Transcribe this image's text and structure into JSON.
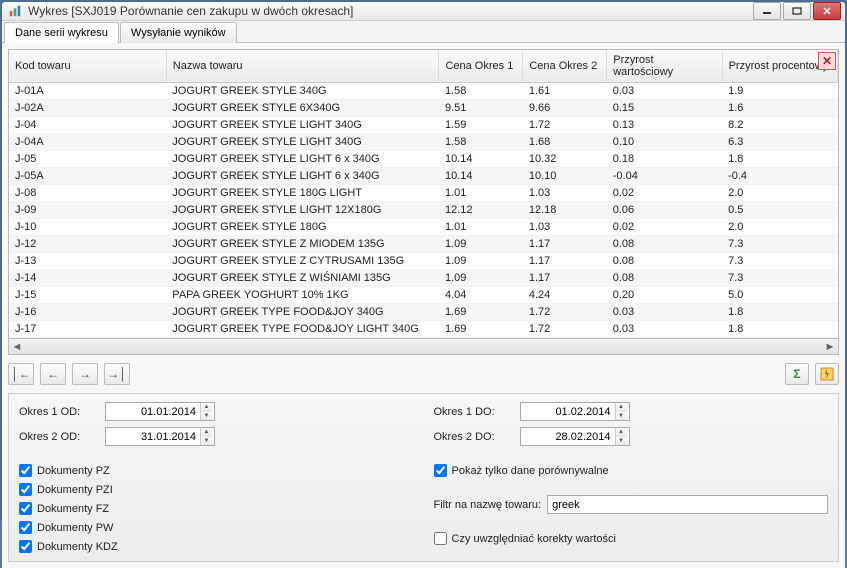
{
  "window": {
    "title": "Wykres [SXJ019 Porównanie cen zakupu w dwóch okresach]"
  },
  "tabs": [
    {
      "label": "Dane serii wykresu"
    },
    {
      "label": "Wysyłanie wyników"
    }
  ],
  "columns": {
    "kod": "Kod towaru",
    "nazwa": "Nazwa towaru",
    "c1": "Cena Okres 1",
    "c2": "Cena Okres 2",
    "pw": "Przyrost wartościowy",
    "pp": "Przyrost procentowy"
  },
  "rows": [
    {
      "kod": "J-01A",
      "nazwa": "JOGURT GREEK STYLE 340G",
      "c1": "1.58",
      "c2": "1.61",
      "pw": "0.03",
      "pp": "1.9"
    },
    {
      "kod": "J-02A",
      "nazwa": "JOGURT GREEK STYLE 6X340G",
      "c1": "9.51",
      "c2": "9.66",
      "pw": "0.15",
      "pp": "1.6"
    },
    {
      "kod": "J-04",
      "nazwa": "JOGURT GREEK STYLE LIGHT 340G",
      "c1": "1.59",
      "c2": "1.72",
      "pw": "0.13",
      "pp": "8.2"
    },
    {
      "kod": "J-04A",
      "nazwa": "JOGURT GREEK STYLE LIGHT 340G",
      "c1": "1.58",
      "c2": "1.68",
      "pw": "0.10",
      "pp": "6.3"
    },
    {
      "kod": "J-05",
      "nazwa": "JOGURT GREEK STYLE LIGHT 6 x 340G",
      "c1": "10.14",
      "c2": "10.32",
      "pw": "0.18",
      "pp": "1.8"
    },
    {
      "kod": "J-05A",
      "nazwa": "JOGURT GREEK STYLE LIGHT 6 x 340G",
      "c1": "10.14",
      "c2": "10.10",
      "pw": "-0.04",
      "pp": "-0.4"
    },
    {
      "kod": "J-08",
      "nazwa": "JOGURT GREEK STYLE 180G LIGHT",
      "c1": "1.01",
      "c2": "1.03",
      "pw": "0.02",
      "pp": "2.0"
    },
    {
      "kod": "J-09",
      "nazwa": "JOGURT GREEK STYLE LIGHT 12X180G",
      "c1": "12.12",
      "c2": "12.18",
      "pw": "0.06",
      "pp": "0.5"
    },
    {
      "kod": "J-10",
      "nazwa": "JOGURT GREEK STYLE 180G",
      "c1": "1.01",
      "c2": "1.03",
      "pw": "0.02",
      "pp": "2.0"
    },
    {
      "kod": "J-12",
      "nazwa": "JOGURT GREEK STYLE Z MIODEM 135G",
      "c1": "1.09",
      "c2": "1.17",
      "pw": "0.08",
      "pp": "7.3"
    },
    {
      "kod": "J-13",
      "nazwa": "JOGURT GREEK STYLE Z CYTRUSAMI 135G",
      "c1": "1.09",
      "c2": "1.17",
      "pw": "0.08",
      "pp": "7.3"
    },
    {
      "kod": "J-14",
      "nazwa": "JOGURT GREEK STYLE Z WIŚNIAMI 135G",
      "c1": "1.09",
      "c2": "1.17",
      "pw": "0.08",
      "pp": "7.3"
    },
    {
      "kod": "J-15",
      "nazwa": "PAPA GREEK YOGHURT 10% 1KG",
      "c1": "4.04",
      "c2": "4.24",
      "pw": "0.20",
      "pp": "5.0"
    },
    {
      "kod": "J-16",
      "nazwa": "JOGURT GREEK TYPE FOOD&JOY 340G",
      "c1": "1.69",
      "c2": "1.72",
      "pw": "0.03",
      "pp": "1.8"
    },
    {
      "kod": "J-17",
      "nazwa": "JOGURT GREEK TYPE FOOD&JOY LIGHT 340G",
      "c1": "1.69",
      "c2": "1.72",
      "pw": "0.03",
      "pp": "1.8"
    }
  ],
  "dates": {
    "okres1od_label": "Okres 1 OD:",
    "okres1od_value": "01.01.2014",
    "okres2od_label": "Okres 2 OD:",
    "okres2od_value": "31.01.2014",
    "okres1do_label": "Okres 1 DO:",
    "okres1do_value": "01.02.2014",
    "okres2do_label": "Okres 2 DO:",
    "okres2do_value": "28.02.2014"
  },
  "checks": {
    "pz": "Dokumenty PZ",
    "pzi": "Dokumenty PZI",
    "fz": "Dokumenty FZ",
    "pw": "Dokumenty PW",
    "kdz": "Dokumenty KDZ",
    "porownywalne": "Pokaż tylko dane porównywalne",
    "korekty": "Czy uwzględniać korekty wartości"
  },
  "filter": {
    "label": "Filtr na nazwę towaru:",
    "value": "greek"
  }
}
